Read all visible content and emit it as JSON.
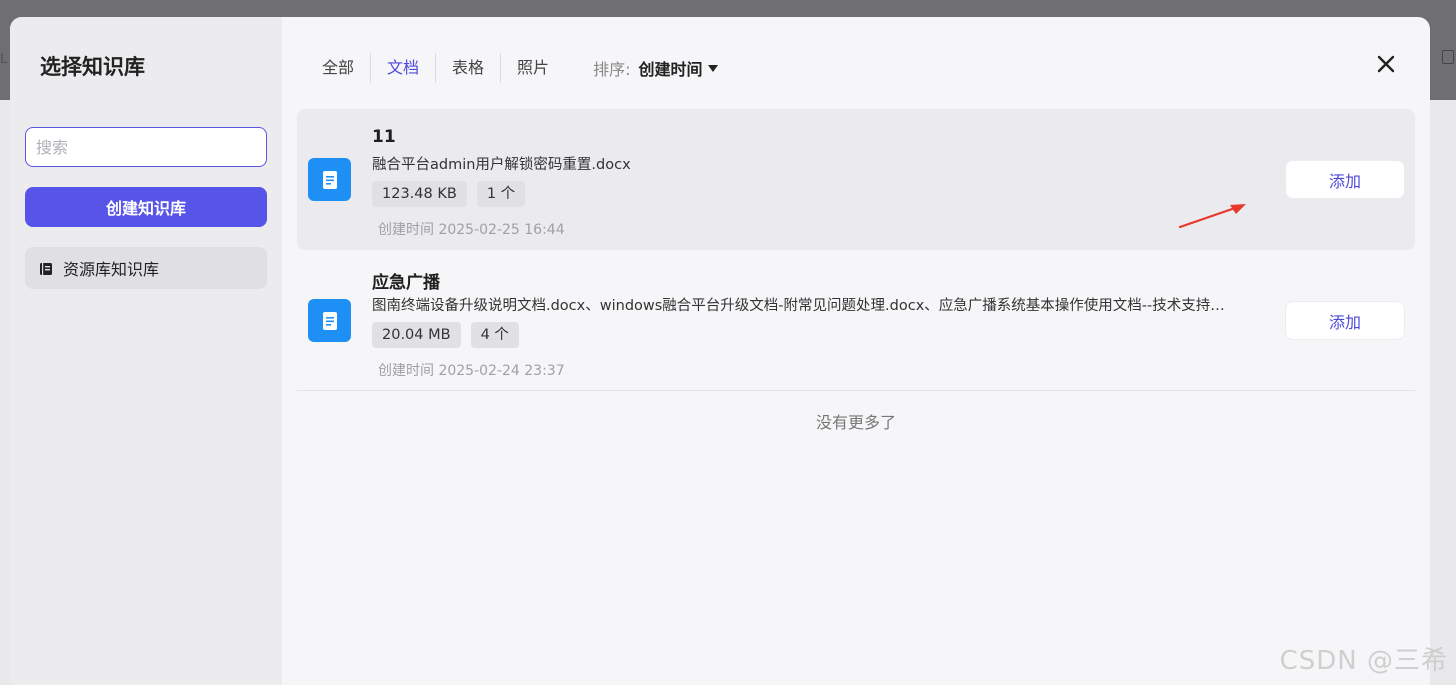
{
  "sidebar": {
    "title": "选择知识库",
    "search_placeholder": "搜索",
    "create_button": "创建知识库",
    "items": [
      {
        "label": "资源库知识库",
        "icon": "book-icon"
      }
    ]
  },
  "tabs": [
    {
      "label": "全部",
      "active": false
    },
    {
      "label": "文档",
      "active": true
    },
    {
      "label": "表格",
      "active": false
    },
    {
      "label": "照片",
      "active": false
    }
  ],
  "sort": {
    "label": "排序:",
    "value": "创建时间"
  },
  "documents": [
    {
      "title": "11",
      "files": "融合平台admin用户解锁密码重置.docx",
      "size": "123.48 KB",
      "count": "1 个",
      "created": "创建时间 2025-02-25 16:44",
      "add_label": "添加"
    },
    {
      "title": "应急广播",
      "files": "图南终端设备升级说明文档.docx、windows融合平台升级文档-附常见问题处理.docx、应急广播系统基本操作使用文档--技术支持…",
      "size": "20.04 MB",
      "count": "4 个",
      "created": "创建时间 2025-02-24 23:37",
      "add_label": "添加"
    }
  ],
  "no_more": "没有更多了",
  "watermark": "CSDN @三希",
  "colors": {
    "accent": "#5754e8",
    "doc_icon": "#1e90f5",
    "arrow": "#e8382a"
  }
}
